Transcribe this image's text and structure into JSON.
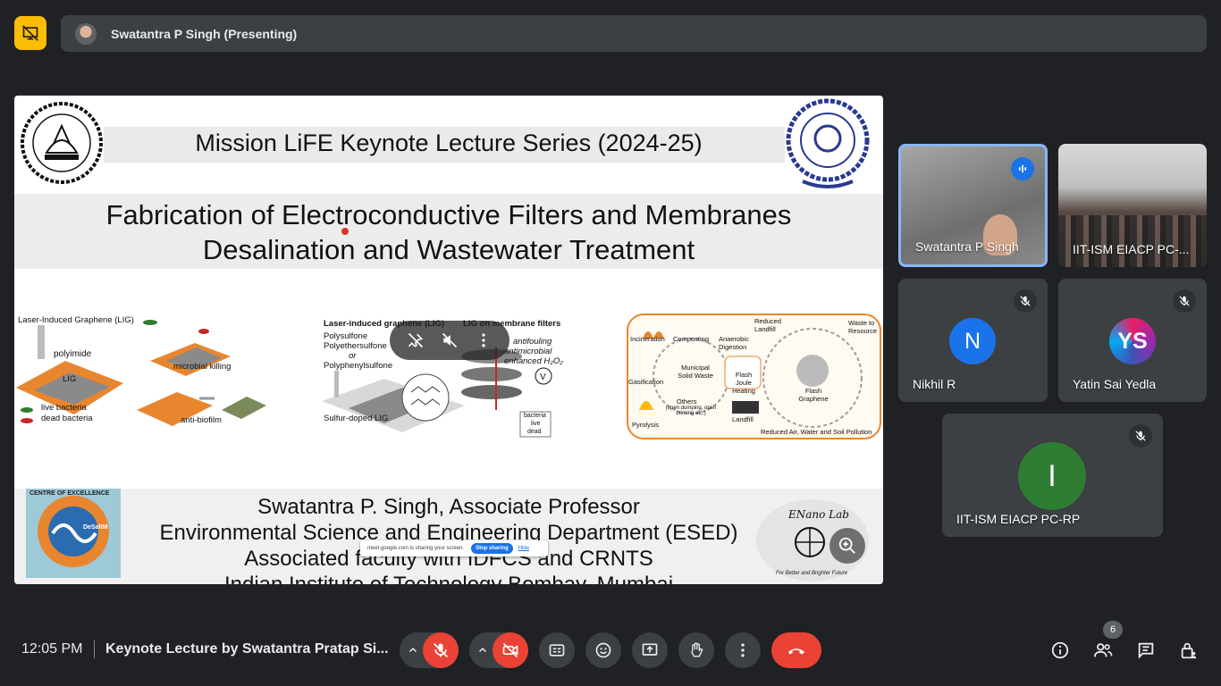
{
  "top_bar": {
    "presenting_label": "Swatantra P Singh (Presenting)"
  },
  "slide": {
    "series_title": "Mission LiFE Keynote Lecture Series (2024-25)",
    "talk_title_line1": "Fabrication of Electroconductive Filters and Membranes",
    "talk_title_line2": "Desalination and Wastewater Treatment",
    "figure1": {
      "label_lig": "Laser-Induced Graphene (LIG)",
      "label_polyimide": "polyimide",
      "label_lig_short": "LIG",
      "label_microbial": "microbial killing",
      "label_live": "live bacteria",
      "label_dead": "dead bacteria",
      "label_antibiofilm": "anti-biofilm"
    },
    "figure2": {
      "label_lig": "Laser-induced graphene (LIG)",
      "label_lig_membrane": "LIG on membrane filters",
      "label_polysulfone": "Polysulfone",
      "label_polyethersulfone": "Polyethersulfone",
      "label_or": "or",
      "label_polyphenylsulfone": "Polyphenylsulfone",
      "label_antifouling": "antifouling",
      "label_antimicrobial": "antimicrobial",
      "label_enhanced": "enhanced H₂O₂",
      "label_sulfur": "Sulfur-doped LIG",
      "label_bacteria": "bacteria",
      "label_fig_live": "live",
      "label_fig_dead": "dead"
    },
    "figure3": {
      "incineration": "Incineration",
      "composting": "Composting",
      "anaerobic": "Anaerobic Digestion",
      "reduced_landfill": "Reduced Landfill",
      "waste_to_resource": "Waste to Resource",
      "gasification": "Gasification",
      "msw": "Municipal Solid Waste",
      "flash_joule": "Flash Joule Heating",
      "flash_graphene": "Flash Graphene",
      "others": "Others",
      "others_detail": "(open dumping, open burning etc.)",
      "landfill": "Landfill",
      "pyrolysis": "Pyrolysis",
      "reduced_pollution": "Reduced Air, Water and Soil Pollution"
    },
    "affiliation_line1": "Swatantra P. Singh, Associate Professor",
    "affiliation_line2": "Environmental Science and Engineering Department (ESED)",
    "affiliation_line3": "Associated faculty with IDFCS and CRNTS",
    "affiliation_line4": "Indian Institute of Technology Bombay, Mumbai",
    "coe_logo_text": "CENTRE OF EXCELLENCE",
    "coe_logo_sub": "DeSaltM",
    "enano_logo_text": "ENano Lab",
    "enano_tagline": "For Better and Brighter Future",
    "share_banner": {
      "message": "meet.google.com is sharing your screen.",
      "stop_label": "Stop sharing",
      "hide_label": "Hide"
    }
  },
  "participants": [
    {
      "name": "Swatantra P Singh",
      "speaking": true
    },
    {
      "name": "IIT-ISM EIACP PC-...",
      "muted": false
    },
    {
      "name": "Nikhil R",
      "initial": "N",
      "avatar_color": "#1a73e8",
      "muted": true
    },
    {
      "name": "Yatin Sai Yedla",
      "initial": "YS",
      "muted": true
    },
    {
      "name": "IIT-ISM EIACP PC-RP",
      "initial": "I",
      "avatar_color": "#2e7d32",
      "muted": true
    }
  ],
  "bottom_bar": {
    "time": "12:05 PM",
    "meeting_title": "Keynote Lecture by Swatantra Pratap Si...",
    "participant_count": "6"
  },
  "colors": {
    "background": "#202124",
    "surface": "#3c4043",
    "danger": "#ea4335",
    "presenting_accent": "#fbbc04",
    "speaking_blue": "#1a73e8"
  }
}
